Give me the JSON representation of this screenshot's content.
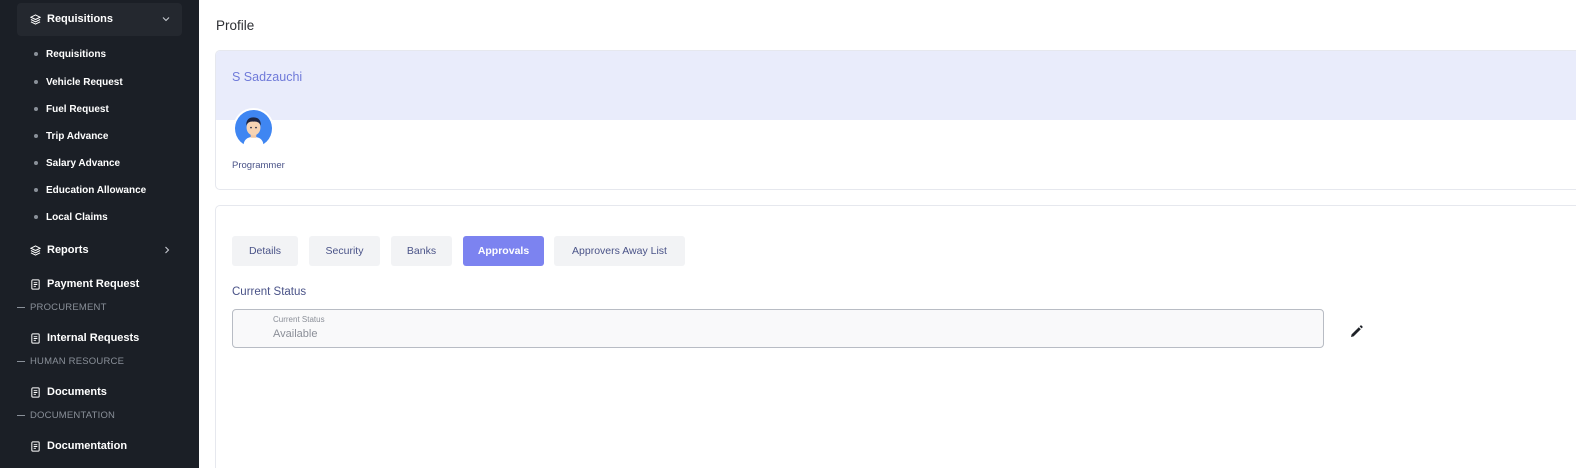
{
  "sidebar": {
    "requisitions_group": "Requisitions",
    "requisition_items": [
      "Requisitions",
      "Vehicle Request",
      "Fuel Request",
      "Trip Advance",
      "Salary Advance",
      "Education Allowance",
      "Local Claims"
    ],
    "reports": "Reports",
    "payment_request": "Payment Request",
    "section_procurement": "PROCUREMENT",
    "internal_requests": "Internal Requests",
    "section_human_resource": "HUMAN RESOURCE",
    "documents": "Documents",
    "section_documentation": "DOCUMENTATION",
    "documentation": "Documentation"
  },
  "page": {
    "title": "Profile"
  },
  "profile": {
    "name": "S Sadzauchi",
    "role": "Programmer"
  },
  "tabs": [
    {
      "label": "Details",
      "active": false
    },
    {
      "label": "Security",
      "active": false
    },
    {
      "label": "Banks",
      "active": false
    },
    {
      "label": "Approvals",
      "active": true
    },
    {
      "label": "Approvers Away List",
      "active": false
    }
  ],
  "status": {
    "section_label": "Current Status",
    "field_label": "Current Status",
    "value": "Available"
  },
  "colors": {
    "sidebar_bg": "#1b1f26",
    "accent": "#7c83f0",
    "banner_bg": "#e9ecfb",
    "name_color": "#6f7ad9",
    "text_navy": "#4a5388"
  }
}
